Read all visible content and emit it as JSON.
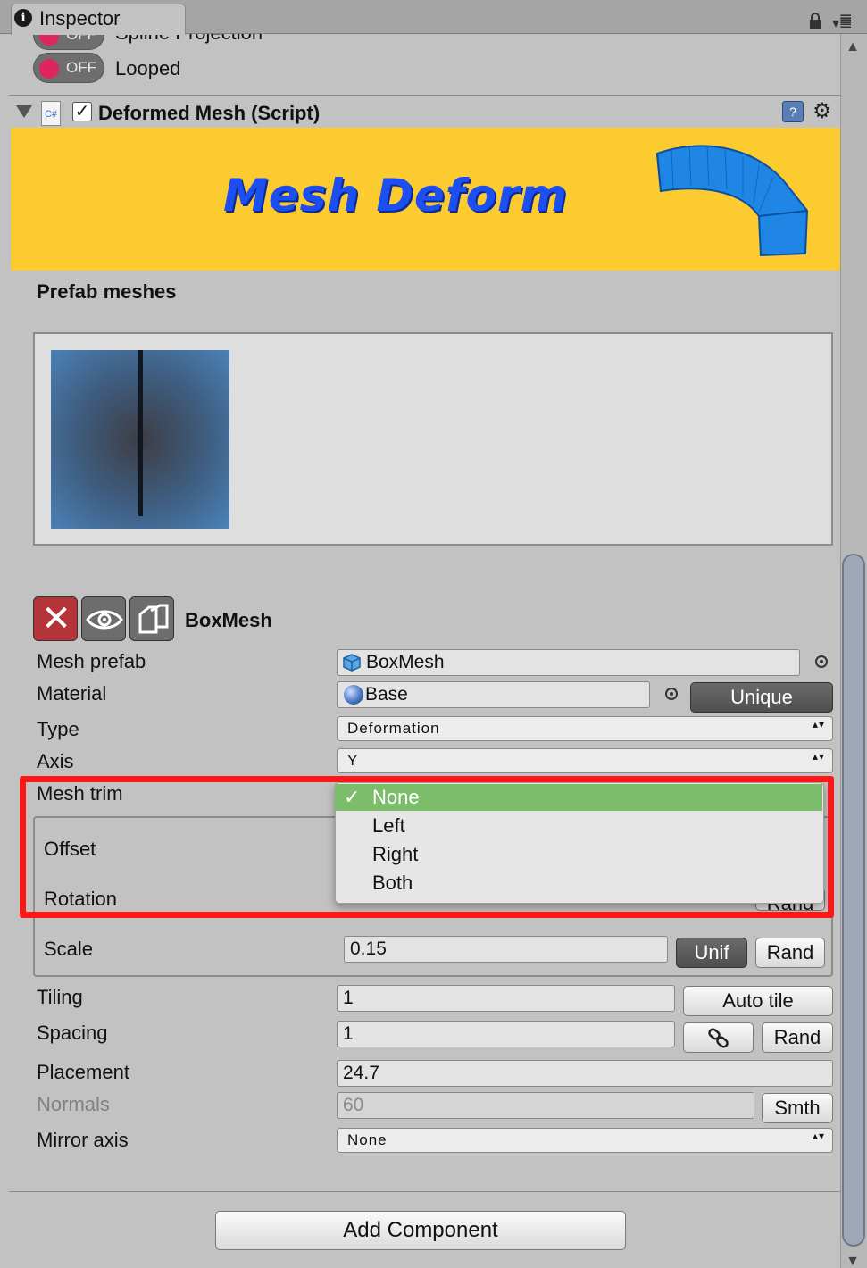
{
  "tab": {
    "label": "Inspector",
    "info_glyph": "i"
  },
  "header_icons": {
    "menu_glyph": "▾☰"
  },
  "scroll": {
    "up_glyph": "▲",
    "down_glyph": "▼"
  },
  "top_rows": {
    "spline_projection": {
      "toggle": "OFF",
      "label": "Spline Projection"
    },
    "looped": {
      "toggle": "OFF",
      "label": "Looped"
    }
  },
  "component": {
    "title": "Deformed Mesh (Script)",
    "enabled_glyph": "✓",
    "script_glyph": "C#",
    "help_glyph": "?",
    "gear_glyph": "⚙"
  },
  "banner": {
    "title": "Mesh Deform",
    "bg": "#fbcb30",
    "title_color": "#1c4ef0"
  },
  "prefab": {
    "heading": "Prefab meshes"
  },
  "mesh": {
    "name": "BoxMesh",
    "delete_glyph": "✕",
    "rows": {
      "mesh_prefab": {
        "label": "Mesh prefab",
        "value": "BoxMesh"
      },
      "material": {
        "label": "Material",
        "value": "Base",
        "button": "Unique"
      },
      "type": {
        "label": "Type",
        "value": "Deformation"
      },
      "axis": {
        "label": "Axis",
        "value": "Y"
      },
      "mesh_trim": {
        "label": "Mesh trim"
      },
      "offset": {
        "label": "Offset"
      },
      "rotation": {
        "label": "Rotation",
        "rand": "Rand"
      },
      "scale": {
        "label": "Scale",
        "value": "0.15",
        "unif": "Unif",
        "rand": "Rand"
      },
      "tiling": {
        "label": "Tiling",
        "value": "1",
        "button": "Auto tile"
      },
      "spacing": {
        "label": "Spacing",
        "value": "1",
        "rand": "Rand"
      },
      "placement": {
        "label": "Placement",
        "value": "24.7"
      },
      "normals": {
        "label": "Normals",
        "value": "60",
        "button": "Smth"
      },
      "mirror_axis": {
        "label": "Mirror axis",
        "value": "None"
      }
    }
  },
  "popup": {
    "options": [
      "None",
      "Left",
      "Right",
      "Both"
    ],
    "selected": "None",
    "check_glyph": "✓",
    "selected_color": "#7bbd6a",
    "highlight_color": "#ff1717"
  },
  "add_component": "Add Component",
  "dropdown_arrows": "▴▾"
}
